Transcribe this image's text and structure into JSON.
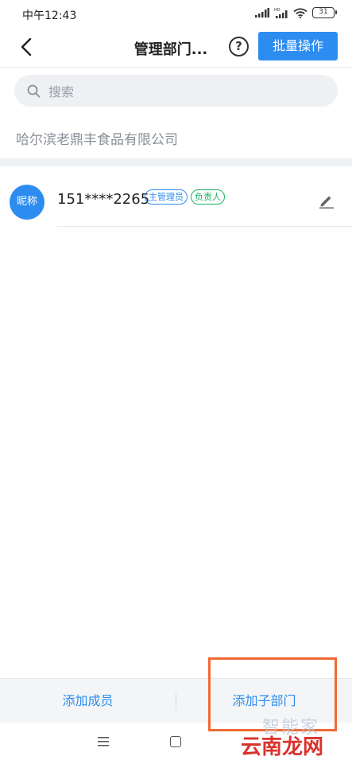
{
  "status_bar": {
    "time": "中午12:43",
    "battery": "31",
    "icons": [
      "signal-icon",
      "hd-signal-icon",
      "wifi-icon",
      "battery-icon"
    ]
  },
  "header": {
    "back_icon": "chevron-left-icon",
    "title": "管理部门...",
    "help_label": "?",
    "batch_button": "批量操作"
  },
  "search": {
    "placeholder": "搜索",
    "icon": "search-icon"
  },
  "company": {
    "name": "哈尔滨老鼎丰食品有限公司"
  },
  "members": [
    {
      "avatar_text": "昵称",
      "phone": "151****2265",
      "tags": [
        "主管理员",
        "负责人"
      ],
      "edit_icon": "pencil-icon"
    }
  ],
  "bottom_bar": {
    "add_member": "添加成员",
    "add_sub_department": "添加子部门"
  },
  "watermark": {
    "top": "智能家",
    "bottom": "云南龙网"
  },
  "colors": {
    "accent": "#2d8cf0",
    "tag_owner": "#19b35a",
    "highlight": "#f06a35",
    "watermark_red": "#d9332c"
  }
}
